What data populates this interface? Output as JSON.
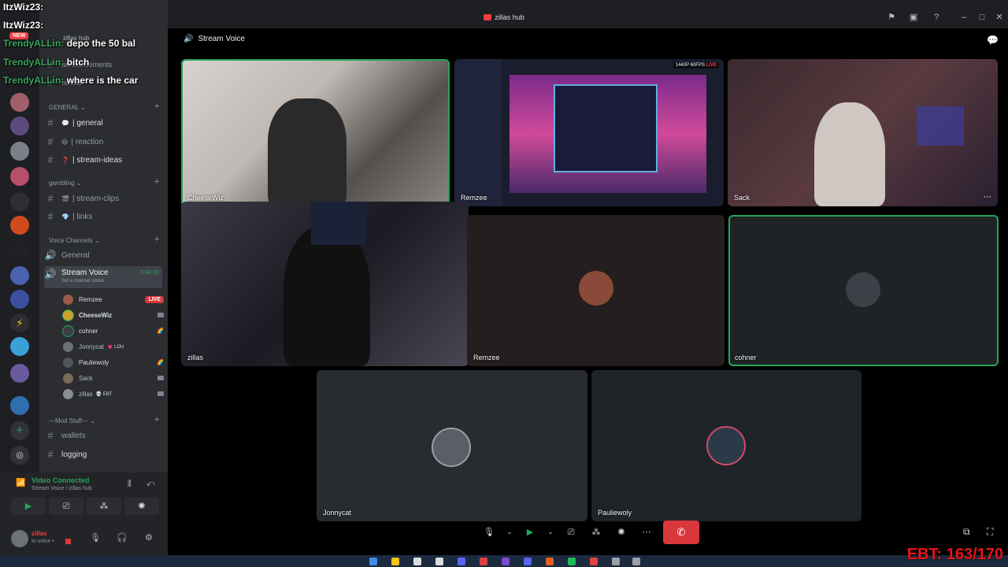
{
  "window": {
    "title": "zillas hub"
  },
  "server": {
    "name": "zillas hub"
  },
  "sidebar": {
    "top_channels": [
      {
        "label": "announcements"
      },
      {
        "label": "tickets"
      }
    ],
    "categories": [
      {
        "name": "GENERAL",
        "channels": [
          {
            "emoji": "💬",
            "label": "| general",
            "bright": true
          },
          {
            "emoji": "😆",
            "label": "| reaction",
            "bright": false
          },
          {
            "emoji": "❓",
            "label": "| stream-ideas",
            "bright": true
          }
        ]
      },
      {
        "name": "gambling",
        "channels": [
          {
            "emoji": "🎬",
            "label": "| stream-clips",
            "bright": false
          },
          {
            "emoji": "💎",
            "label": "| links",
            "bright": false
          }
        ]
      }
    ],
    "voice_category": "Voice Channels",
    "voice_channels": [
      {
        "label": "General"
      },
      {
        "label": "Stream Voice",
        "timer": "6:34:00",
        "status": "Set a channel status"
      }
    ],
    "voice_users": [
      {
        "name": "Remzee",
        "badge": "LIVE",
        "color": "#9c5b48"
      },
      {
        "name": "CheeseWiz",
        "badge": "",
        "color": "#c9a227"
      },
      {
        "name": "cohner",
        "badge": "",
        "color": "#3a3d42"
      },
      {
        "name": "Jonnycat",
        "badge": "💗 LOU",
        "color": "#6b6f78"
      },
      {
        "name": "Pauliewoly",
        "badge": "",
        "color": "#52555c"
      },
      {
        "name": "Sack",
        "badge": "",
        "color": "#7a6a5a"
      },
      {
        "name": "zillas",
        "badge": "💀 EBT",
        "color": "#8a8e94"
      }
    ],
    "mod_category": "---Mod Stuff---",
    "mod_channels": [
      {
        "label": "wallets"
      },
      {
        "label": "logging"
      }
    ]
  },
  "voice_panel": {
    "title": "Video Connected",
    "subtitle": "Stream Voice / zillas hub"
  },
  "user_panel": {
    "name": "zillas",
    "status": "In voice •"
  },
  "main": {
    "header": "Stream Voice",
    "tiles": [
      {
        "name": "CheeseWiz"
      },
      {
        "name": "Remzee",
        "stream_badge": "1440P 60FPS",
        "live": "LIVE"
      },
      {
        "name": "Sack"
      },
      {
        "name": "zillas"
      },
      {
        "name": "Remzee"
      },
      {
        "name": "cohner"
      },
      {
        "name": "Jonnycat"
      },
      {
        "name": "Pauliewoly"
      }
    ]
  },
  "chat_overlay": [
    {
      "user": "ItzWiz23:",
      "msg": "",
      "user_white": true
    },
    {
      "user": "ItzWiz23:",
      "msg": "",
      "user_white": true
    },
    {
      "user": "TrendyALLin:",
      "msg": "depo the 50 bal",
      "user_white": false
    },
    {
      "user": "TrendyALLin:",
      "msg": "bitch",
      "user_white": false
    },
    {
      "user": "TrendyALLin:",
      "msg": "where is the car",
      "user_white": false
    }
  ],
  "new_badge": "NEW",
  "ebt_counter": "EBT: 163/170",
  "colors": {
    "accent_green": "#23a55a",
    "live_red": "#da373c",
    "bg": "#1e1f22",
    "sidebar": "#2b2d31"
  }
}
